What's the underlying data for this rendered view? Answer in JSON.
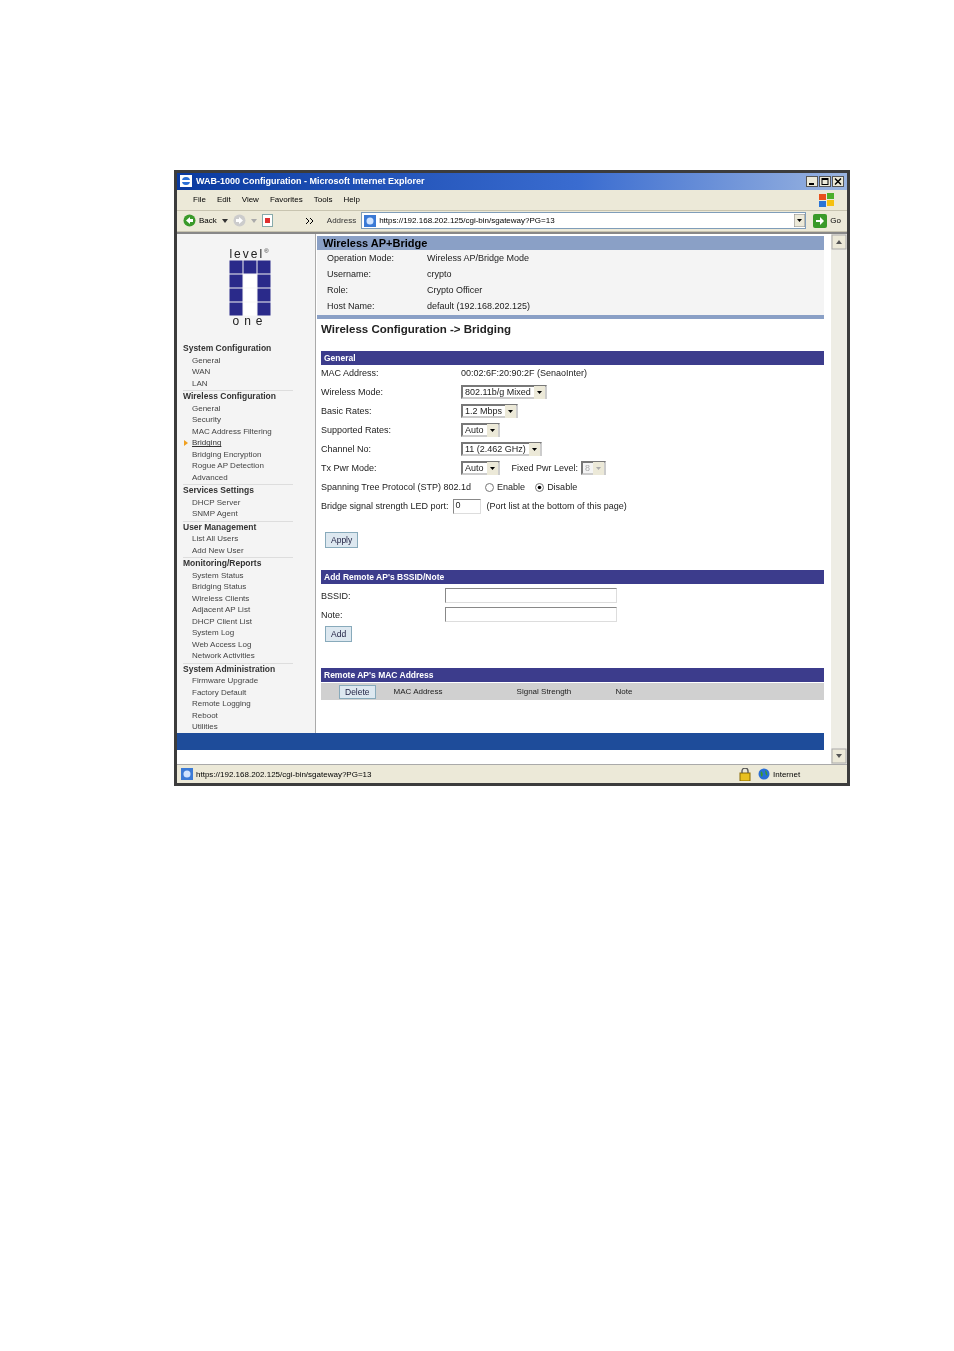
{
  "window": {
    "title": "WAB-1000 Configuration - Microsoft Internet Explorer"
  },
  "menu": [
    "File",
    "Edit",
    "View",
    "Favorites",
    "Tools",
    "Help"
  ],
  "toolbar": {
    "back": "Back",
    "address_label": "Address",
    "url": "https://192.168.202.125/cgi-bin/sgateway?PG=13",
    "go": "Go"
  },
  "logo": {
    "top": "level$^{®}$",
    "bottom": "one"
  },
  "sidebar": [
    {
      "title": "System Configuration",
      "items": [
        {
          "label": "General",
          "selected": false
        },
        {
          "label": "WAN",
          "selected": false
        },
        {
          "label": "LAN",
          "selected": false
        }
      ]
    },
    {
      "title": "Wireless Configuration",
      "items": [
        {
          "label": "General",
          "selected": false
        },
        {
          "label": "Security",
          "selected": false
        },
        {
          "label": "MAC Address Filtering",
          "selected": false
        },
        {
          "label": "Bridging",
          "selected": true
        },
        {
          "label": "Bridging Encryption",
          "selected": false
        },
        {
          "label": "Rogue AP Detection",
          "selected": false
        },
        {
          "label": "Advanced",
          "selected": false
        }
      ]
    },
    {
      "title": "Services Settings",
      "items": [
        {
          "label": "DHCP Server",
          "selected": false
        },
        {
          "label": "SNMP Agent",
          "selected": false
        }
      ]
    },
    {
      "title": "User Management",
      "items": [
        {
          "label": "List All Users",
          "selected": false
        },
        {
          "label": "Add New User",
          "selected": false
        }
      ]
    },
    {
      "title": "Monitoring/Reports",
      "items": [
        {
          "label": "System Status",
          "selected": false
        },
        {
          "label": "Bridging Status",
          "selected": false
        },
        {
          "label": "Wireless Clients",
          "selected": false
        },
        {
          "label": "Adjacent AP List",
          "selected": false
        },
        {
          "label": "DHCP Client List",
          "selected": false
        },
        {
          "label": "System Log",
          "selected": false
        },
        {
          "label": "Web Access Log",
          "selected": false
        },
        {
          "label": "Network Activities",
          "selected": false
        }
      ]
    },
    {
      "title": "System Administration",
      "items": [
        {
          "label": "Firmware Upgrade",
          "selected": false
        },
        {
          "label": "Factory Default",
          "selected": false
        },
        {
          "label": "Remote Logging",
          "selected": false
        },
        {
          "label": "Reboot",
          "selected": false
        },
        {
          "label": "Utilities",
          "selected": false
        }
      ]
    }
  ],
  "header": {
    "title": "Wireless AP+Bridge",
    "rows": [
      {
        "label": "Operation Mode:",
        "value": "Wireless AP/Bridge Mode"
      },
      {
        "label": "Username:",
        "value": "crypto"
      },
      {
        "label": "Role:",
        "value": "Crypto Officer"
      },
      {
        "label": "Host Name:",
        "value": "default (192.168.202.125)"
      }
    ]
  },
  "page_title": "Wireless Configuration -> Bridging",
  "general": {
    "title": "General",
    "fields": [
      {
        "kind": "text",
        "label": "MAC Address:",
        "value": "00:02:6F:20:90:2F (SenaoInter)"
      },
      {
        "kind": "select",
        "label": "Wireless Mode:",
        "value": "802.11b/g Mixed"
      },
      {
        "kind": "select",
        "label": "Basic Rates:",
        "value": "1.2 Mbps"
      },
      {
        "kind": "select",
        "label": "Supported Rates:",
        "value": "Auto"
      },
      {
        "kind": "select",
        "label": "Channel No:",
        "value": "11 (2.462 GHz)"
      },
      {
        "kind": "select_pair",
        "label": "Tx Pwr Mode:",
        "value": "Auto",
        "second": {
          "label": "Fixed Pwr Level:",
          "value": "8",
          "disabled": true
        }
      },
      {
        "kind": "radio",
        "label": "Spanning Tree Protocol (STP) 802.1d",
        "options": [
          {
            "label": "Enable",
            "selected": false
          },
          {
            "label": "Disable",
            "selected": true
          }
        ]
      },
      {
        "kind": "input",
        "label": "Bridge signal strength LED port:",
        "value": "0",
        "note": "(Port list at the bottom of this page)"
      }
    ],
    "button": "Apply"
  },
  "remote_form": {
    "title": "Add Remote AP's BSSID/Note",
    "fields": [
      {
        "label": "BSSID:"
      },
      {
        "label": "Note:"
      }
    ],
    "button": "Add"
  },
  "remote_table": {
    "title": "Remote AP's MAC Address",
    "button": "Delete",
    "columns": [
      "MAC Address",
      "Signal Strength",
      "Note"
    ]
  },
  "status_bar": {
    "url": "https://192.168.202.125/cgi-bin/sgateway?PG=13",
    "zone": "Internet"
  }
}
